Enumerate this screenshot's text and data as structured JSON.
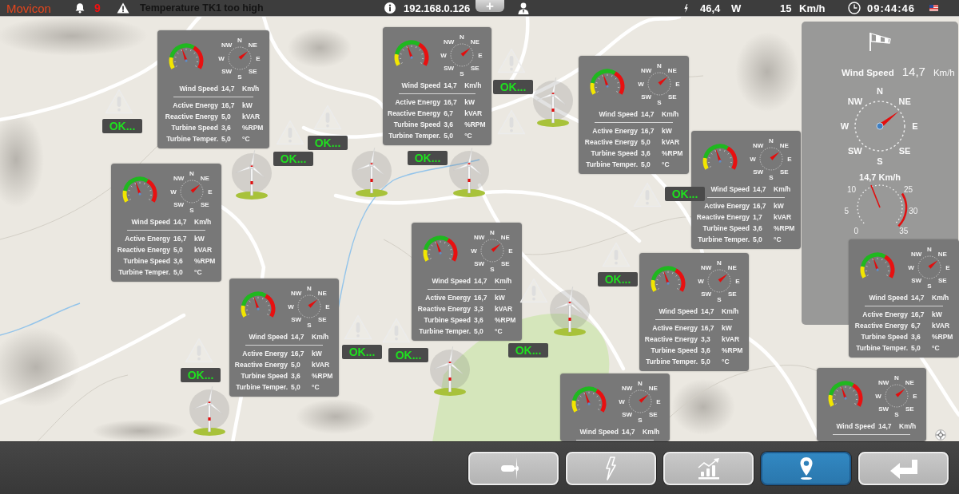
{
  "top_bar": {
    "app_name": "Movicon",
    "alarm_count": "9",
    "alarm_message": "Temperature TK1 too high",
    "ip_address": "192.168.0.126",
    "tab_label": "+",
    "power": {
      "value": "46,4",
      "unit": "W"
    },
    "wind": {
      "value": "15",
      "unit": "Km/h"
    },
    "time": "09:44:46"
  },
  "wind_panel": {
    "label": "Wind Speed",
    "value": "14,7",
    "unit": "Km/h",
    "compass": [
      "N",
      "NE",
      "E",
      "SE",
      "S",
      "SW",
      "W",
      "NW"
    ],
    "gauge": {
      "level": 0.42,
      "reading": "14,7 Km/h",
      "scale": [
        "10",
        "25",
        "5",
        "30",
        "0",
        "35"
      ]
    }
  },
  "turbine_panels": [
    {
      "gauge": {
        "level": 0.42
      },
      "compass": [
        "N",
        "NE",
        "E",
        "SE",
        "S",
        "SW",
        "W",
        "NW"
      ],
      "wind_speed": {
        "label": "Wind Speed",
        "value": "14,7",
        "unit": "Km/h"
      },
      "rows": [
        {
          "label": "Active Energy",
          "value": "16,7",
          "unit": "kW"
        },
        {
          "label": "Reactive Energy",
          "value": "5,0",
          "unit": "kVAR"
        },
        {
          "label": "Turbine Speed",
          "value": "3,6",
          "unit": "%RPM"
        },
        {
          "label": "Turbine Temper.",
          "value": "5,0",
          "unit": "°C"
        }
      ]
    },
    {
      "gauge": {
        "level": 0.42
      },
      "compass": [
        "N",
        "NE",
        "E",
        "SE",
        "S",
        "SW",
        "W",
        "NW"
      ],
      "wind_speed": {
        "label": "Wind Speed",
        "value": "14,7",
        "unit": "Km/h"
      },
      "rows": [
        {
          "label": "Active Energy",
          "value": "16,7",
          "unit": "kW"
        },
        {
          "label": "Reactive Energy",
          "value": "6,7",
          "unit": "kVAR"
        },
        {
          "label": "Turbine Speed",
          "value": "3,6",
          "unit": "%RPM"
        },
        {
          "label": "Turbine Temper.",
          "value": "5,0",
          "unit": "°C"
        }
      ]
    },
    {
      "gauge": {
        "level": 0.42
      },
      "compass": [
        "N",
        "NE",
        "E",
        "SE",
        "S",
        "SW",
        "W",
        "NW"
      ],
      "wind_speed": {
        "label": "Wind Speed",
        "value": "14,7",
        "unit": "Km/h"
      },
      "rows": [
        {
          "label": "Active Energy",
          "value": "16,7",
          "unit": "kW"
        },
        {
          "label": "Reactive Energy",
          "value": "5,0",
          "unit": "kVAR"
        },
        {
          "label": "Turbine Speed",
          "value": "3,6",
          "unit": "%RPM"
        },
        {
          "label": "Turbine Temper.",
          "value": "5,0",
          "unit": "°C"
        }
      ]
    },
    {
      "gauge": {
        "level": 0.42
      },
      "compass": [
        "N",
        "NE",
        "E",
        "SE",
        "S",
        "SW",
        "W",
        "NW"
      ],
      "wind_speed": {
        "label": "Wind Speed",
        "value": "14,7",
        "unit": "Km/h"
      },
      "rows": [
        {
          "label": "Active Energy",
          "value": "16,7",
          "unit": "kW"
        },
        {
          "label": "Reactive Energy",
          "value": "5,0",
          "unit": "kVAR"
        },
        {
          "label": "Turbine Speed",
          "value": "3,6",
          "unit": "%RPM"
        },
        {
          "label": "Turbine Temper.",
          "value": "5,0",
          "unit": "°C"
        }
      ]
    },
    {
      "gauge": {
        "level": 0.42
      },
      "compass": [
        "N",
        "NE",
        "E",
        "SE",
        "S",
        "SW",
        "W",
        "NW"
      ],
      "wind_speed": {
        "label": "Wind Speed",
        "value": "14,7",
        "unit": "Km/h"
      },
      "rows": [
        {
          "label": "Active Energy",
          "value": "16,7",
          "unit": "kW"
        },
        {
          "label": "Reactive Energy",
          "value": "1,7",
          "unit": "kVAR"
        },
        {
          "label": "Turbine Speed",
          "value": "3,6",
          "unit": "%RPM"
        },
        {
          "label": "Turbine Temper.",
          "value": "5,0",
          "unit": "°C"
        }
      ]
    },
    {
      "gauge": {
        "level": 0.42
      },
      "compass": [
        "N",
        "NE",
        "E",
        "SE",
        "S",
        "SW",
        "W",
        "NW"
      ],
      "wind_speed": {
        "label": "Wind Speed",
        "value": "14,7",
        "unit": "Km/h"
      },
      "rows": [
        {
          "label": "Active Energy",
          "value": "16,7",
          "unit": "kW"
        },
        {
          "label": "Reactive Energy",
          "value": "3,3",
          "unit": "kVAR"
        },
        {
          "label": "Turbine Speed",
          "value": "3,6",
          "unit": "%RPM"
        },
        {
          "label": "Turbine Temper.",
          "value": "5,0",
          "unit": "°C"
        }
      ]
    },
    {
      "gauge": {
        "level": 0.42
      },
      "compass": [
        "N",
        "NE",
        "E",
        "SE",
        "S",
        "SW",
        "W",
        "NW"
      ],
      "wind_speed": {
        "label": "Wind Speed",
        "value": "14,7",
        "unit": "Km/h"
      },
      "rows": [
        {
          "label": "Active Energy",
          "value": "16,7",
          "unit": "kW"
        },
        {
          "label": "Reactive Energy",
          "value": "5,0",
          "unit": "kVAR"
        },
        {
          "label": "Turbine Speed",
          "value": "3,6",
          "unit": "%RPM"
        },
        {
          "label": "Turbine Temper.",
          "value": "5,0",
          "unit": "°C"
        }
      ]
    },
    {
      "gauge": {
        "level": 0.42
      },
      "compass": [
        "N",
        "NE",
        "E",
        "SE",
        "S",
        "SW",
        "W",
        "NW"
      ],
      "wind_speed": {
        "label": "Wind Speed",
        "value": "14,7",
        "unit": "Km/h"
      },
      "rows": [
        {
          "label": "Active Energy",
          "value": "16,7",
          "unit": "kW"
        },
        {
          "label": "Reactive Energy",
          "value": "3,3",
          "unit": "kVAR"
        },
        {
          "label": "Turbine Speed",
          "value": "3,6",
          "unit": "%RPM"
        },
        {
          "label": "Turbine Temper.",
          "value": "5,0",
          "unit": "°C"
        }
      ]
    },
    {
      "gauge": {
        "level": 0.42
      },
      "compass": [
        "N",
        "NE",
        "E",
        "SE",
        "S",
        "SW",
        "W",
        "NW"
      ],
      "wind_speed": {
        "label": "Wind Speed",
        "value": "14,7",
        "unit": "Km/h"
      },
      "rows": [
        {
          "label": "Active Energy",
          "value": "16,7",
          "unit": "kW"
        },
        {
          "label": "Reactive Energy",
          "value": "6,7",
          "unit": "kVAR"
        },
        {
          "label": "Turbine Speed",
          "value": "3,6",
          "unit": "%RPM"
        },
        {
          "label": "Turbine Temper.",
          "value": "5,0",
          "unit": "°C"
        }
      ]
    },
    {
      "gauge": {
        "level": 0.42
      },
      "compass": [
        "N",
        "NE",
        "E",
        "SE",
        "S",
        "SW",
        "W",
        "NW"
      ],
      "wind_speed": {
        "label": "Wind Speed",
        "value": "14,7",
        "unit": "Km/h"
      }
    },
    {
      "gauge": {
        "level": 0.42
      },
      "compass": [
        "N",
        "NE",
        "E",
        "SE",
        "S",
        "SW",
        "W",
        "NW"
      ],
      "wind_speed": {
        "label": "Wind Speed",
        "value": "14,7",
        "unit": "Km/h"
      }
    }
  ],
  "status_badges": [
    {
      "text": "OK..."
    },
    {
      "text": "OK..."
    },
    {
      "text": "OK..."
    },
    {
      "text": "OK..."
    },
    {
      "text": "OK..."
    },
    {
      "text": "OK..."
    },
    {
      "text": "OK..."
    },
    {
      "text": "OK..."
    },
    {
      "text": "OK..."
    },
    {
      "text": "OK..."
    },
    {
      "text": "OK..."
    }
  ],
  "nav_buttons": [
    {
      "selected": false
    },
    {
      "selected": false
    },
    {
      "selected": false
    },
    {
      "selected": true
    },
    {
      "selected": false
    }
  ]
}
